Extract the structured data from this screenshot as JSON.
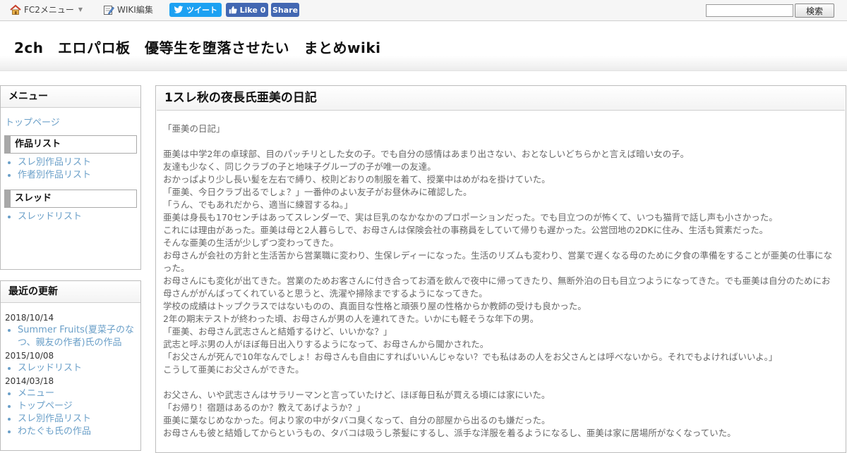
{
  "topbar": {
    "fc2menu_label": "FC2メニュー",
    "wikiedit_label": "WIKI編集",
    "tweet_label": "ツイート",
    "like_label": "Like 0",
    "share_label": "Share",
    "search_value": "",
    "search_button": "検索"
  },
  "header": {
    "title": "2ch　エロパロ板　優等生を堕落させたい　まとめwiki"
  },
  "menu": {
    "heading": "メニュー",
    "top_link": "トップページ",
    "works_heading": "作品リスト",
    "works_items": [
      "スレ別作品リスト",
      "作者別作品リスト"
    ],
    "thread_heading": "スレッド",
    "thread_items": [
      "スレッドリスト"
    ]
  },
  "recent": {
    "heading": "最近の更新",
    "groups": [
      {
        "date": "2018/10/14",
        "items": [
          "Summer Fruits(夏菜子のなつ、親友の作者)氏の作品"
        ]
      },
      {
        "date": "2015/10/08",
        "items": [
          "スレッドリスト"
        ]
      },
      {
        "date": "2014/03/18",
        "items": [
          "メニュー",
          "トップページ",
          "スレ別作品リスト",
          "わたぐも氏の作品"
        ]
      }
    ]
  },
  "main": {
    "title": "1スレ秋の夜長氏亜美の日記",
    "lines": [
      "「亜美の日記」",
      "",
      "亜美は中学2年の卓球部、目のパッチリとした女の子。でも自分の感情はあまり出さない、おとなしいどちらかと言えば暗い女の子。",
      "友達も少なく、同じクラブの子と地味子グループの子が唯一の友達。",
      "おかっぱより少し長い髪を左右で縛り、校則どおりの制服を着て、授業中はめがねを掛けていた。",
      "「亜美、今日クラブ出るでしょ？」一番仲のよい友子がお昼休みに確認した。",
      "「うん、でもあれだから、適当に練習するね。」",
      "亜美は身長も170センチはあってスレンダーで、実は巨乳のなかなかのプロポーションだった。でも目立つのが怖くて、いつも猫背で話し声も小さかった。",
      "これには理由があった。亜美は母と2人暮らしで、お母さんは保険会社の事務員をしていて帰りも遅かった。公営団地の2DKに住み、生活も質素だった。",
      "そんな亜美の生活が少しずつ変わってきた。",
      "お母さんが会社の方針と生活苦から営業職に変わり、生保レディーになった。生活のリズムも変わり、営業で遅くなる母のために夕食の準備をすることが亜美の仕事になった。",
      "お母さんにも変化が出てきた。営業のためお客さんに付き合ってお酒を飲んで夜中に帰ってきたり、無断外泊の日も目立つようになってきた。でも亜美は自分のためにお母さんががんばってくれていると思うと、洗濯や掃除までするようになってきた。",
      "学校の成績はトップクラスではないものの、真面目な性格と頑張り屋の性格からか教師の受けも良かった。",
      "2年の期末テストが終わった頃、お母さんが男の人を連れてきた。いかにも軽そうな年下の男。",
      "「亜美、お母さん武志さんと結婚するけど、いいかな？」",
      "武志と呼ぶ男の人がほぼ毎日出入りするようになって、お母さんから聞かされた。",
      "「お父さんが死んで10年なんでしょ！お母さんも自由にすればいいんじゃない？でも私はあの人をお父さんとは呼べないから。それでもよければいいよ。」",
      "こうして亜美にお父さんができた。",
      "",
      "お父さん、いや武志さんはサラリーマンと言っていたけど、ほぼ毎日私が買える頃には家にいた。",
      "「お帰り！宿題はあるのか？教えてあげようか？」",
      "亜美に葉なじめなかった。何より家の中がタバコ臭くなって、自分の部屋から出るのも嫌だった。",
      "お母さんも彼と結婚してからというもの、タバコは吸うし茶髪にするし、派手な洋服を着るようになるし、亜美は家に居場所がなくなっていた。"
    ]
  }
}
